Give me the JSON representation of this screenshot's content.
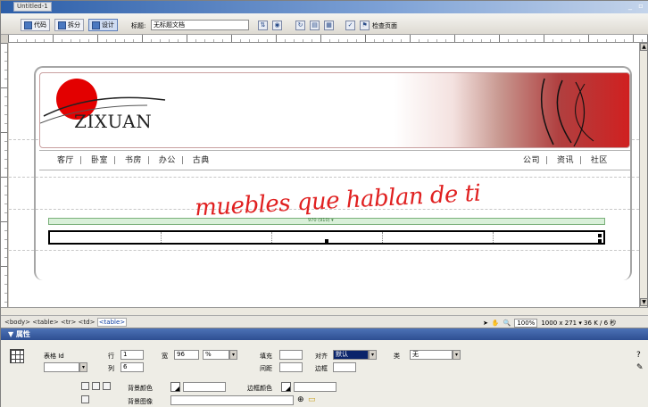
{
  "window": {
    "title": "Untitled-1"
  },
  "doc_toolbar": {
    "view_code": "代码",
    "view_split": "拆分",
    "view_design": "设计",
    "title_label": "标题:",
    "title_value": "无标题文档",
    "check_page": "检查页面"
  },
  "page": {
    "brand": "ZIXUAN",
    "nav_left": [
      "客厅",
      "卧室",
      "书房",
      "办公",
      "古典"
    ],
    "nav_right": [
      "公司",
      "资讯",
      "社区"
    ],
    "tagline": "muebles que hablan de ti",
    "table_width": "970 (910) ▾"
  },
  "status": {
    "tags": "<body> <table> <tr> <td> ",
    "selected_tag": "<table>",
    "zoom": "100%",
    "size": "1000 x 271 ▾ 36 K / 6 秒"
  },
  "properties": {
    "header": "▼ 属性",
    "table_label": "表格 Id",
    "rows_label": "行",
    "rows_value": "1",
    "cols_label": "列",
    "cols_value": "6",
    "width_label": "宽",
    "width_value": "96",
    "width_unit": "%",
    "padding_label": "填充",
    "spacing_label": "间距",
    "border_label": "边框",
    "align_label": "对齐",
    "align_value": "默认",
    "class_label": "类",
    "class_value": "无",
    "bg_color_label": "背景颜色",
    "border_color_label": "边框颜色",
    "bg_image_label": "背景图像"
  }
}
